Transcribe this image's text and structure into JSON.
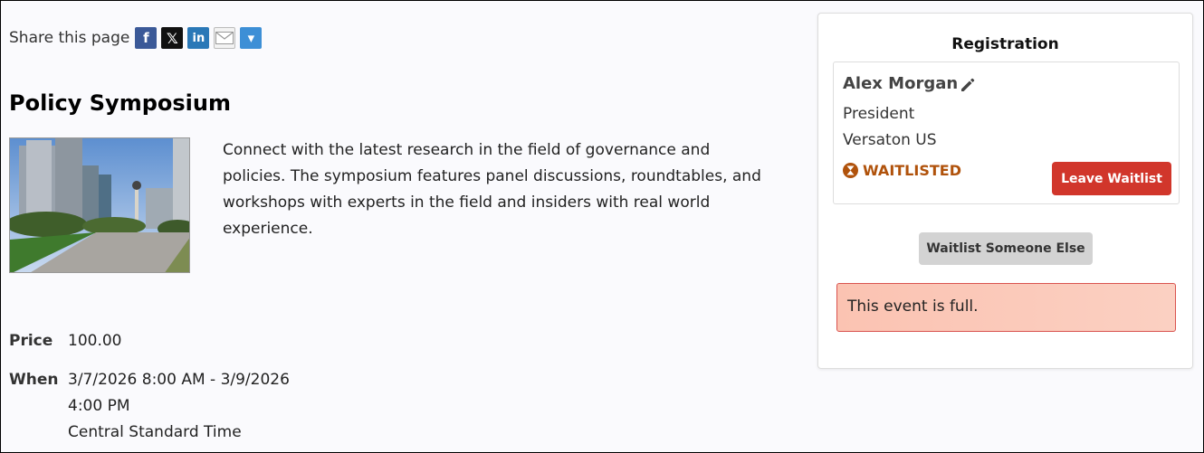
{
  "share": {
    "label": "Share this page",
    "icons": [
      "facebook-icon",
      "x-icon",
      "linkedin-icon",
      "email-icon",
      "more-share-icon"
    ],
    "fb_glyph": "f",
    "x_glyph": "𝕏",
    "li_glyph": "in",
    "more_glyph": "▾"
  },
  "event": {
    "title": "Policy Symposium",
    "description": "Connect with the latest research in the field of governance and policies. The symposium features panel discussions, roundtables, and workshops with experts in the field and insiders with real world experience.",
    "price_label": "Price",
    "price_value": "100.00",
    "when_label": "When",
    "when_line1": "3/7/2026 8:00 AM - 3/9/2026",
    "when_line2": "4:00 PM",
    "when_line3": "Central Standard Time"
  },
  "registration": {
    "title": "Registration",
    "name": "Alex Morgan",
    "role": "President",
    "organization": "Versaton US",
    "status": "WAITLISTED",
    "leave_button": "Leave Waitlist",
    "waitlist_else_button": "Waitlist Someone Else",
    "alert": "This event is full."
  },
  "colors": {
    "status": "#b0520b",
    "leave_button": "#d1362b",
    "alert_border": "#d9534f"
  }
}
